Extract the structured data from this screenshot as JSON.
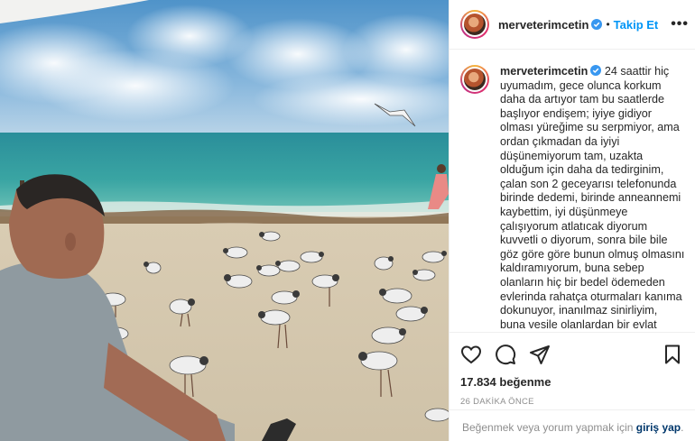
{
  "post": {
    "username": "merveterimcetin",
    "separator": "•",
    "follow_label": "Takip Et",
    "more_label": "•••"
  },
  "caption": {
    "username": "merveterimcetin",
    "text": "24 saattir hiç uyumadım, gece olunca korkum daha da artıyor tam bu saatlerde başlıyor endişem; iyiye gidiyor olması yüreğime su serpmiyor, ama ordan çıkmadan da iyiyi düşünemiyorum tam, uzakta olduğum için daha da tedirginim, çalan son 2 geceyarısı telefonunda birinde dedemi, birinde anneannemi kaybettim, iyi düşünmeye çalışıyorum atlatıcak diyorum kuvvetli o diyorum, sonra bile bile göz göre göre bunun olmuş olmasını kaldıramıyorum, buna sebep olanların hiç bir bedel ödemeden evlerinda rahatça oturmaları kanıma dokunuyor, inanılmaz sinirliyim, buna vesile olanlardan bir evlat olarak teker teker hesap sormak istiyorum, haksızlığa uğradığımı düşünüyorum ve isyan"
  },
  "stats": {
    "likes": "17.834 beğenme",
    "time_ago": "26 DAKİKA ÖNCE"
  },
  "footer": {
    "prompt": "Beğenmek veya yorum yapmak için",
    "link": "giriş yap",
    "period": "."
  },
  "icons": {
    "verified": "verified-badge-icon",
    "like": "heart-icon",
    "comment": "comment-icon",
    "share": "paper-plane-icon",
    "save": "bookmark-icon",
    "more": "more-options-icon"
  },
  "colors": {
    "link_blue": "#0095f6",
    "text": "#262626",
    "muted": "#8e8e8e",
    "login_link": "#00376b"
  }
}
